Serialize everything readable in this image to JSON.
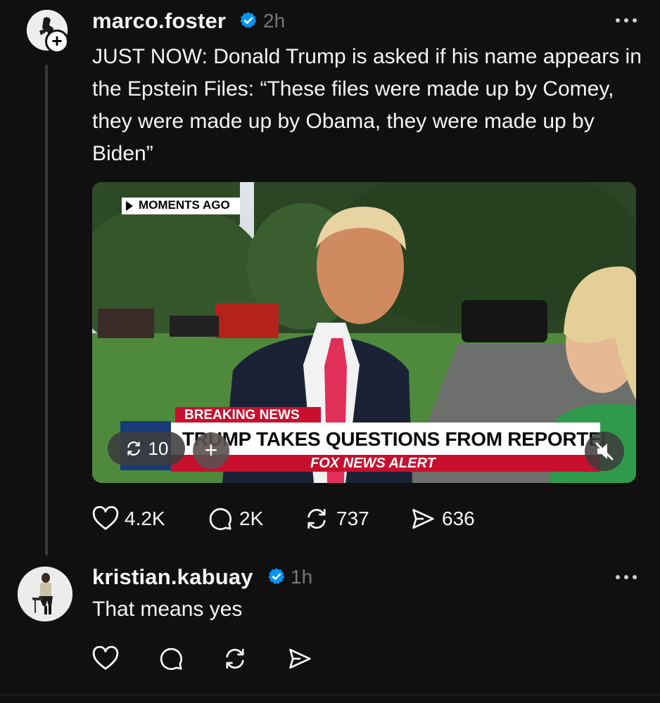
{
  "post": {
    "username": "marco.foster",
    "time": "2h",
    "text": "JUST NOW: Donald Trump is asked if his name appears in the Epstein Files: “These files were made up by Comey, they were made up by Obama, they were made up by Biden”",
    "video": {
      "overlay_tag": "MOMENTS AGO",
      "breaking_label": "BREAKING NEWS",
      "headline": "TRUMP TAKES QUESTIONS FROM REPORTERS",
      "network_alert": "FOX NEWS ALERT",
      "repost_count": "10"
    },
    "actions": {
      "likes": "4.2K",
      "replies": "2K",
      "reposts": "737",
      "shares": "636"
    }
  },
  "reply": {
    "username": "kristian.kabuay",
    "time": "1h",
    "text": "That means yes"
  },
  "colors": {
    "background": "#101010",
    "verified": "#0095f6",
    "muted_text": "#777777",
    "breaking_red": "#c8102e"
  }
}
